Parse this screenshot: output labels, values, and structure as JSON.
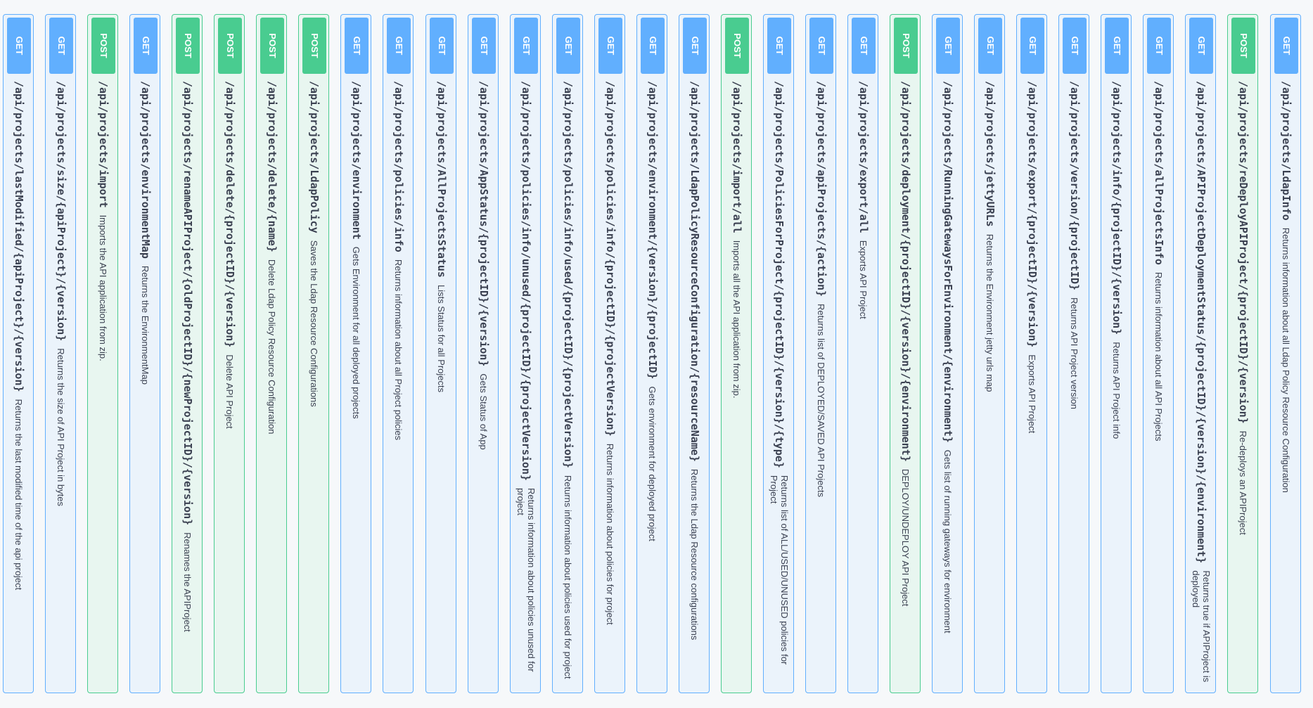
{
  "operations": [
    {
      "method": "GET",
      "path": "/api/projects/lastModified/{apiProject}/{version}",
      "summary": "Returns the last modified time of the api project"
    },
    {
      "method": "GET",
      "path": "/api/projects/size/{apiProject}/{version}",
      "summary": "Returns the size of API Project in bytes"
    },
    {
      "method": "POST",
      "path": "/api/projects/import",
      "summary": "Imports the API application from zip."
    },
    {
      "method": "GET",
      "path": "/api/projects/environmentMap",
      "summary": "Returns the EnvironmentMap"
    },
    {
      "method": "POST",
      "path": "/api/projects/renameAPIProject/{oldProjectID}/{newProjectID}/{version}",
      "summary": "Renames the APIProject"
    },
    {
      "method": "POST",
      "path": "/api/projects/delete/{projectID}/{version}",
      "summary": "Delete API Project"
    },
    {
      "method": "POST",
      "path": "/api/projects/delete/{name}",
      "summary": "Delete Ldap Policy Resource Configuration"
    },
    {
      "method": "POST",
      "path": "/api/projects/LdapPolicy",
      "summary": "Saves the Ldap Resource Configurations"
    },
    {
      "method": "GET",
      "path": "/api/projects/environment",
      "summary": "Gets Environment for all deployed projects"
    },
    {
      "method": "GET",
      "path": "/api/projects/policies/info",
      "summary": "Returns information about all Project policies"
    },
    {
      "method": "GET",
      "path": "/api/projects/AllProjectsStatus",
      "summary": "Lists Status for all Projects"
    },
    {
      "method": "GET",
      "path": "/api/projects/AppStatus/{projectID}/{version}",
      "summary": "Gets Status of App"
    },
    {
      "method": "GET",
      "path": "/api/projects/policies/info/unused/{projectID}/{projectVersion}",
      "summary": "Returns information about policies unused for project"
    },
    {
      "method": "GET",
      "path": "/api/projects/policies/info/used/{projectID}/{projectVersion}",
      "summary": "Returns information about policies used for project"
    },
    {
      "method": "GET",
      "path": "/api/projects/policies/info/{projectID}/{projectVersion}",
      "summary": "Returns information about policies for project"
    },
    {
      "method": "GET",
      "path": "/api/projects/environment/{version}/{projectID}",
      "summary": "Gets environment for deployed project"
    },
    {
      "method": "GET",
      "path": "/api/projects/LdapPolicyResourceConfiguration/{resourceName}",
      "summary": "Returns the Ldap Resource configurations"
    },
    {
      "method": "POST",
      "path": "/api/projects/import/all",
      "summary": "Imports all the API application from zip."
    },
    {
      "method": "GET",
      "path": "/api/projects/PoliciesForProject/{projectID}/{version}/{type}",
      "summary": "Returns list of ALL/USED/UNUSED policies for Project"
    },
    {
      "method": "GET",
      "path": "/api/projects/apiProjects/{action}",
      "summary": "Returns list of DEPLOYED/SAVED API Projects"
    },
    {
      "method": "GET",
      "path": "/api/projects/export/all",
      "summary": "Exports API Project"
    },
    {
      "method": "POST",
      "path": "/api/projects/deployment/{projectID}/{version}/{environment}",
      "summary": "DEPLOY/UNDEPLOY API Project"
    },
    {
      "method": "GET",
      "path": "/api/projects/RunningGatewaysForEnvironment/{environment}",
      "summary": "Gets list of running gateways for environment"
    },
    {
      "method": "GET",
      "path": "/api/projects/jettyURLs",
      "summary": "Returns the Environment jetty urls map"
    },
    {
      "method": "GET",
      "path": "/api/projects/export/{projectID}/{version}",
      "summary": "Exports API Project"
    },
    {
      "method": "GET",
      "path": "/api/projects/version/{projectID}",
      "summary": "Returns API Project version"
    },
    {
      "method": "GET",
      "path": "/api/projects/info/{projectID}/{version}",
      "summary": "Returns API Project info"
    },
    {
      "method": "GET",
      "path": "/api/projects/allProjectsInfo",
      "summary": "Returns information about all API Projects"
    },
    {
      "method": "GET",
      "path": "/api/projects/APIProjectDeploymentStatus/{projectID}/{version}/{environment}",
      "summary": "Returns true if APIProject is deployed"
    },
    {
      "method": "POST",
      "path": "/api/projects/reDeployAPIProject/{projectID}/{version}",
      "summary": "Re-deploys an APIProject"
    },
    {
      "method": "GET",
      "path": "/api/projects/LdapInfo",
      "summary": "Returns information about all Ldap Policy Resource Configuration"
    }
  ],
  "colors": {
    "get": "#61affe",
    "post": "#49cc90",
    "text": "#3b4151"
  }
}
